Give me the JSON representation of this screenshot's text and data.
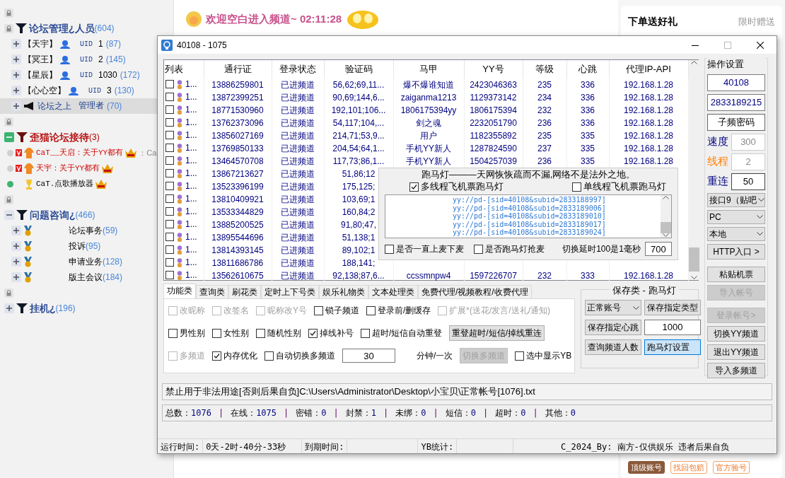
{
  "sidebar": {
    "groups": [
      {
        "title": "论坛管理¿人员",
        "count": "(604)",
        "color": "#1d3f8f",
        "children": [
          {
            "kind": "member",
            "name": "【天宇】",
            "tag": "UID",
            "uid": "1",
            "count": "(87)",
            "selected": false
          },
          {
            "kind": "member",
            "name": "【冥王】",
            "tag": "UID",
            "uid": "2",
            "count": "(145)",
            "selected": false
          },
          {
            "kind": "member",
            "name": "【星辰】",
            "tag": "UID",
            "uid": "1030",
            "count": "(172)",
            "selected": false
          },
          {
            "kind": "member",
            "name": "【心心空】",
            "tag": "UID",
            "uid": "3",
            "count": "(130)",
            "selected": false
          },
          {
            "kind": "admin",
            "name": "论坛之上",
            "tag": "管理者",
            "count": "(70)",
            "selected": true
          }
        ]
      },
      {
        "title": "歪猫论坛接待",
        "count": "(3)",
        "color": "#b00000",
        "expanded": true,
        "children": [
          {
            "kind": "guest",
            "online": false,
            "vip": true,
            "name": "CaT__天启：关于YY都有",
            "suffix": "：Ca"
          },
          {
            "kind": "guest",
            "online": false,
            "vip": true,
            "name": "天宇：关于YY都有"
          },
          {
            "kind": "guest",
            "online": true,
            "vip": false,
            "name": "CaT.点歌播放器"
          }
        ]
      },
      {
        "title": "问题咨询¿",
        "count": "(466)",
        "color": "#1d3f8f",
        "expanded": true,
        "children": [
          {
            "kind": "topic",
            "name": "论坛事务",
            "count": "(59)"
          },
          {
            "kind": "topic",
            "name": "投诉",
            "count": "(95)"
          },
          {
            "kind": "topic",
            "name": "申请业务",
            "count": "(128)"
          },
          {
            "kind": "topic",
            "name": "版主会议",
            "count": "(184)"
          }
        ]
      },
      {
        "title": "挂机¿",
        "count": "(196)",
        "color": "#1d3f8f",
        "expanded": false
      }
    ]
  },
  "banner": {
    "text": "欢迎空白进入频道~ 02:11:28"
  },
  "promo": {
    "title": "下单送好礼",
    "note": "限时赠送",
    "tags": [
      "顶级账号",
      "找回包赔",
      "官方验号"
    ]
  },
  "window": {
    "title": "40108 - 1075"
  },
  "table": {
    "columns": [
      "列表",
      "通行证",
      "登录状态",
      "验证码",
      "马甲",
      "YY号",
      "等级",
      "心跳",
      "代理IP-API"
    ],
    "rows": [
      {
        "checked": false,
        "cells": [
          "1...",
          "13886259801",
          "已进频道",
          "56,62;69,11...",
          "爆不爆谁知道",
          "2423046363",
          "235",
          "336",
          "192.168.1.28"
        ]
      },
      {
        "checked": false,
        "cells": [
          "1...",
          "13872399251",
          "已进频道",
          "90,69;144,6...",
          "zaiganma1213",
          "1129373142",
          "234",
          "336",
          "192.168.1.28"
        ]
      },
      {
        "checked": false,
        "cells": [
          "1...",
          "18771530960",
          "已进频道",
          "192,101;106...",
          "1806175394yy",
          "1806175394",
          "232",
          "336",
          "192.168.1.28"
        ]
      },
      {
        "checked": false,
        "cells": [
          "1...",
          "13762373096",
          "已进频道",
          "54,117;104,...",
          "剑之魂",
          "2232051790",
          "236",
          "336",
          "192.168.1.28"
        ]
      },
      {
        "checked": false,
        "cells": [
          "1...",
          "13856027169",
          "已进频道",
          "214,71;53,9...",
          "用户",
          "1182355892",
          "235",
          "335",
          "192.168.1.28"
        ]
      },
      {
        "checked": false,
        "cells": [
          "1...",
          "13769850133",
          "已进频道",
          "204,54;64,1...",
          "手机YY新人",
          "1287824590",
          "237",
          "335",
          "192.168.1.28"
        ]
      },
      {
        "checked": false,
        "cells": [
          "1...",
          "13464570708",
          "已进频道",
          "117,73;86,1...",
          "手机YY新人",
          "1504257039",
          "236",
          "335",
          "192.168.1.28"
        ]
      },
      {
        "checked": false,
        "cells": [
          "1...",
          "13867213627",
          "已进频道",
          "51,86;12"
        ]
      },
      {
        "checked": false,
        "cells": [
          "1...",
          "13523396199",
          "已进频道",
          "175,125;"
        ]
      },
      {
        "checked": false,
        "cells": [
          "1...",
          "13810409921",
          "已进频道",
          "103,69;1"
        ]
      },
      {
        "checked": false,
        "cells": [
          "1...",
          "13533344829",
          "已进频道",
          "160,84;2"
        ]
      },
      {
        "checked": false,
        "cells": [
          "1...",
          "13885200525",
          "已进频道",
          "91,80;47,"
        ]
      },
      {
        "checked": false,
        "cells": [
          "1...",
          "13895544696",
          "已进频道",
          "51,138;1"
        ]
      },
      {
        "checked": false,
        "cells": [
          "1...",
          "13814393145",
          "已进频道",
          "89,102;1"
        ]
      },
      {
        "checked": false,
        "cells": [
          "1...",
          "13811686786",
          "已进频道",
          "188,141;"
        ]
      },
      {
        "checked": false,
        "cells": [
          "1...",
          "13562610675",
          "已进频道",
          "92,138;87,6...",
          "ccssmnpw4",
          "1597226707",
          "232",
          "333",
          "192.168.1.28"
        ]
      }
    ]
  },
  "marquee": {
    "title": "跑马灯———天网恢恢疏而不漏,网络不是法外之地。",
    "modes": [
      {
        "label": "多线程飞机票跑马灯",
        "checked": true
      },
      {
        "label": "单线程飞机票跑马灯",
        "checked": false
      }
    ],
    "lines": [
      "yy://pd-[sid=40108&subid=2833188997]",
      "yy://pd-[sid=40108&subid=2833189006]",
      "yy://pd-[sid=40108&subid=2833189010]",
      "yy://pd-[sid=40108&subid=2833189017]",
      "yy://pd-[sid=40108&subid=2833189024]"
    ],
    "options": [
      {
        "label": "是否一直上麦下麦",
        "checked": false
      },
      {
        "label": "是否跑马灯抢麦",
        "checked": false
      }
    ],
    "delay_label": "切换延时100是1毫秒",
    "delay_value": "700"
  },
  "tabs": [
    {
      "label": "功能类",
      "selected": true
    },
    {
      "label": "查询类",
      "selected": false
    },
    {
      "label": "刷花类",
      "selected": false
    },
    {
      "label": "定时上下号类",
      "selected": false
    },
    {
      "label": "娱乐礼物类",
      "selected": false
    },
    {
      "label": "文本处理类",
      "selected": false
    },
    {
      "label": "免费代理/视频教程/收费代理",
      "selected": false
    }
  ],
  "functions": [
    [
      {
        "kind": "checkbox",
        "label": "改昵称",
        "checked": false,
        "disabled": true
      },
      {
        "kind": "checkbox",
        "label": "改签名",
        "checked": false,
        "disabled": true
      },
      {
        "kind": "checkbox",
        "label": "昵称改Y号",
        "checked": false,
        "disabled": true
      },
      {
        "kind": "checkbox",
        "label": "锁子频道",
        "checked": false,
        "disabled": false
      },
      {
        "kind": "checkbox",
        "label": "登录前/删缓存",
        "checked": false,
        "disabled": false
      },
      {
        "kind": "checkbox",
        "label": "扩展*(送花/发言/送礼/通知)",
        "checked": false,
        "disabled": true
      }
    ],
    [
      {
        "kind": "checkbox",
        "label": "男性别",
        "checked": false,
        "disabled": false
      },
      {
        "kind": "checkbox",
        "label": "女性别",
        "checked": false,
        "disabled": false
      },
      {
        "kind": "checkbox",
        "label": "随机性别",
        "checked": false,
        "disabled": false
      },
      {
        "kind": "checkbox",
        "label": "掉线补号",
        "checked": true,
        "disabled": false
      },
      {
        "kind": "checkbox",
        "label": "超时/短信自动重登",
        "checked": false,
        "disabled": false
      },
      {
        "kind": "button",
        "label": "重登超时/短信/掉线重连",
        "disabled": false
      }
    ],
    [
      {
        "kind": "checkbox",
        "label": "多频道",
        "checked": false,
        "disabled": true
      },
      {
        "kind": "checkbox",
        "label": "内存优化",
        "checked": true,
        "disabled": false
      },
      {
        "kind": "checkbox",
        "label": "自动切换多频道",
        "checked": false,
        "disabled": false
      },
      {
        "kind": "input",
        "value": "30"
      },
      {
        "kind": "label",
        "label": "分钟/一次"
      },
      {
        "kind": "button",
        "label": "切换多频道",
        "disabled": true
      },
      {
        "kind": "checkbox",
        "label": "选中显示YB",
        "checked": false,
        "disabled": false
      }
    ]
  ],
  "save_group": {
    "title": "保存类 - 跑马灯",
    "select": "正常账号",
    "buttons": [
      {
        "label": "保存指定类型",
        "focused": false
      },
      {
        "label": "保存指定心跳",
        "focused": false
      },
      {
        "label": "查询频道人数",
        "focused": false
      },
      {
        "label": "跑马灯设置",
        "focused": true
      }
    ],
    "heartbeat": "1000"
  },
  "panel": {
    "title": "操作设置",
    "channel": "40108",
    "subchannel": "2833189215",
    "password_button": "子频密码",
    "params": [
      {
        "label": "速度",
        "value": "300",
        "disabled": true,
        "color": "#000080"
      },
      {
        "label": "线程",
        "value": "2",
        "disabled": true,
        "color": "#ff7f00"
      },
      {
        "label": "重连",
        "value": "50",
        "disabled": false,
        "color": "#000080"
      }
    ],
    "selects": [
      "接口9（贴吧",
      "PC",
      "本地"
    ],
    "buttons": [
      {
        "label": "HTTP入口 >",
        "disabled": false
      },
      {
        "label": "粘贴机票",
        "disabled": false
      },
      {
        "label": "导入帐号",
        "disabled": true
      },
      {
        "label": "登录帐号>",
        "disabled": true
      },
      {
        "label": "切换YY频道",
        "disabled": false
      },
      {
        "label": "退出YY频道",
        "disabled": false
      },
      {
        "label": "导入多频道",
        "disabled": false
      }
    ]
  },
  "path": "禁止用于非法用途[否则后果自负]C:\\Users\\Administrator\\Desktop\\小宝贝\\正常帐号[1076].txt",
  "stats": {
    "separator": "|",
    "items": [
      {
        "label": "总数：",
        "value": "1076"
      },
      {
        "label": "在线：",
        "value": "1075"
      },
      {
        "label": "密错：",
        "value": "0"
      },
      {
        "label": "封禁：",
        "value": "1"
      },
      {
        "label": "未绑：",
        "value": "0"
      },
      {
        "label": "短信：",
        "value": "0"
      },
      {
        "label": "超时：",
        "value": "0"
      },
      {
        "label": "其他：",
        "value": "0"
      }
    ]
  },
  "status_bar": {
    "run_label": "运行时间:",
    "run_value": "0天-2时-40分-33秒",
    "expire_label": "到期时间:",
    "yb_label": "YB统计:",
    "credit": "C_2024_By: 南方-仅供娱乐 违者后果自负"
  }
}
